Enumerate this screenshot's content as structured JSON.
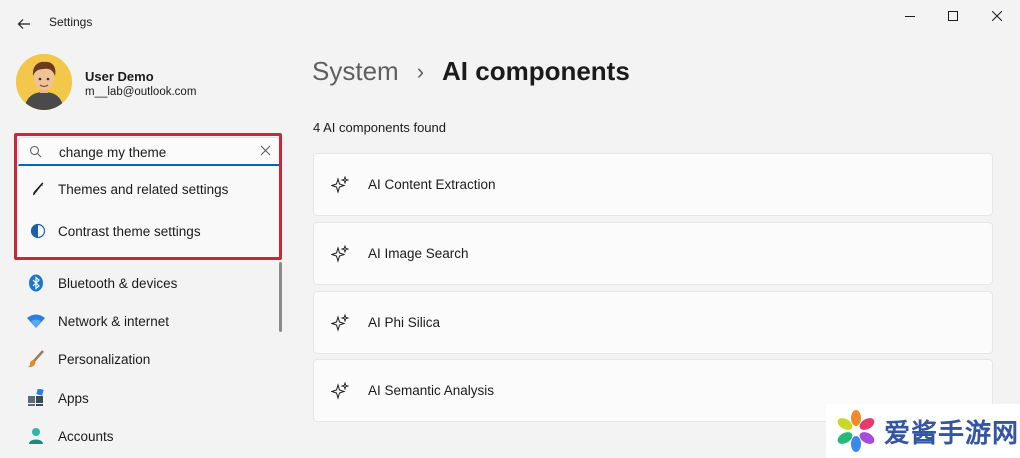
{
  "window": {
    "title": "Settings"
  },
  "user": {
    "name": "User Demo",
    "email": "m__lab@outlook.com"
  },
  "search": {
    "value": "change my theme",
    "suggestions": [
      {
        "label": "Themes and related settings",
        "icon": "brush-icon"
      },
      {
        "label": "Contrast theme settings",
        "icon": "contrast-icon"
      }
    ]
  },
  "nav": {
    "items": [
      {
        "label": "Bluetooth & devices",
        "icon": "bluetooth-icon"
      },
      {
        "label": "Network & internet",
        "icon": "wifi-icon"
      },
      {
        "label": "Personalization",
        "icon": "paintbrush-icon"
      },
      {
        "label": "Apps",
        "icon": "apps-icon"
      },
      {
        "label": "Accounts",
        "icon": "accounts-icon"
      }
    ]
  },
  "main": {
    "breadcrumb_parent": "System",
    "breadcrumb_separator": "›",
    "breadcrumb_current": "AI components",
    "found_text": "4 AI components found",
    "components": [
      {
        "label": "AI Content Extraction",
        "icon": "sparkle-icon"
      },
      {
        "label": "AI Image Search",
        "icon": "sparkle-icon"
      },
      {
        "label": "AI Phi Silica",
        "icon": "sparkle-icon"
      },
      {
        "label": "AI Semantic Analysis",
        "icon": "sparkle-icon"
      }
    ]
  },
  "watermark": {
    "text": "爱酱手游网"
  },
  "colors": {
    "accent": "#0067c0",
    "highlight_border": "#c8283a",
    "background": "#f3f3f3"
  }
}
